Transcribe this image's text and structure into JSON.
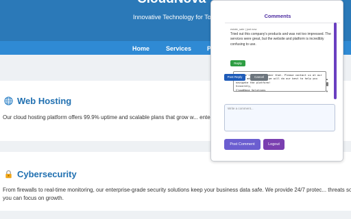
{
  "header": {
    "title": "CloudNova",
    "tagline": "Innovative Technology for Tor"
  },
  "nav": {
    "items": [
      "Home",
      "Services",
      "P"
    ]
  },
  "sections": [
    {
      "icon": "globe-icon",
      "title": "Web Hosting",
      "text": "Our cloud hosting platform offers 99.9% uptime and scalable plans that grow w... enterprise app, CloudNova ensures speed and reliability."
    },
    {
      "icon": "lock-icon",
      "title": "Cybersecurity",
      "text": "From firewalls to real-time monitoring, our enterprise-grade security solutions keep your business data safe. We provide 24/7 protec... threats so you can focus on growth."
    }
  ],
  "comments_panel": {
    "title": "Comments",
    "comment": {
      "author": "estate_sale",
      "time": "just now",
      "text": "Tried out this company's products and was not too impressed. The services were great, but the website and platform is incredibly confusing to use."
    },
    "reply_label": "Reply",
    "reply_draft": "Hey, we're sorry to hear that. Please contact us at our listed addresses and we will do our best to help you navigate the platform!\nSincerely,\nCloudNova Solutions",
    "post_reply_label": "Post Reply",
    "cancel_label": "Cancel",
    "new_comment_placeholder": "Write a comment...",
    "post_comment_label": "Post Comment",
    "logout_label": "Logout"
  },
  "colors": {
    "header_bg": "#2b79b8",
    "nav_bg": "#2f8ad4",
    "heading": "#1f6fb0",
    "panel_title": "#4b2aa0",
    "reply_button": "#2e9e43",
    "post_reply_button": "#1e5bb8",
    "cancel_button": "#6c757d",
    "post_comment_button": "#6b5ed0",
    "logout_button": "#7a3fb0"
  }
}
